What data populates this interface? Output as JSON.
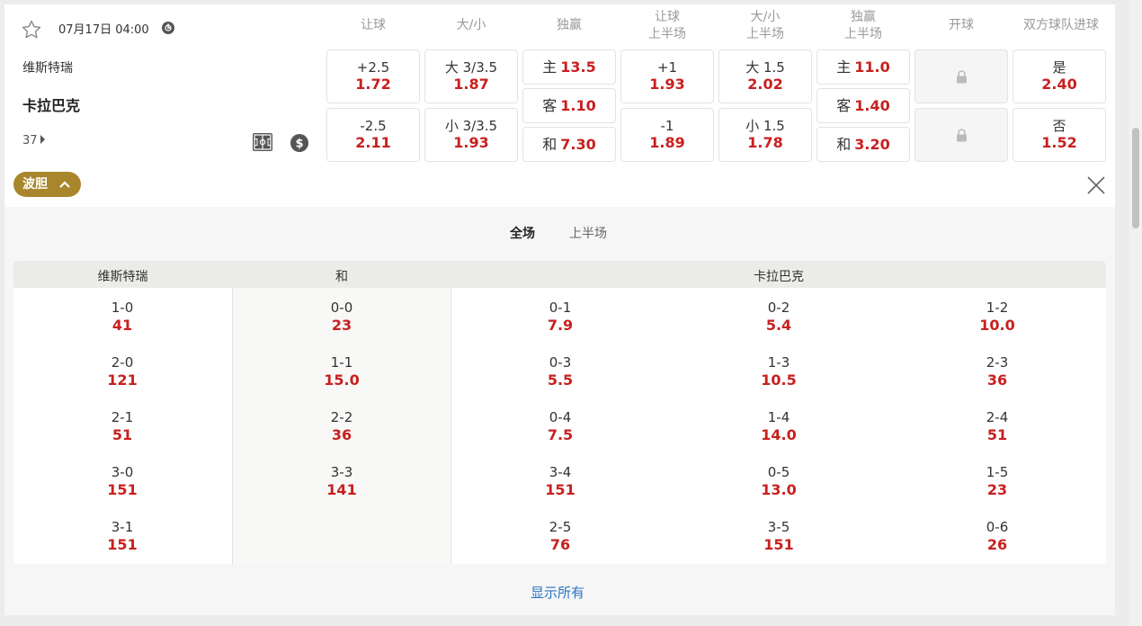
{
  "match": {
    "datetime": "07月17日 04:00",
    "home_team": "维斯特瑞",
    "away_team": "卡拉巴克",
    "more_markets_count": "37"
  },
  "headers": {
    "handicap": "让球",
    "over_under": "大/小",
    "moneyline": "独赢",
    "handicap_1h": [
      "让球",
      "上半场"
    ],
    "over_under_1h": [
      "大/小",
      "上半场"
    ],
    "moneyline_1h": [
      "独赢",
      "上半场"
    ],
    "kickoff": "开球",
    "btts": "双方球队进球"
  },
  "odds": {
    "handicap": [
      {
        "label": "+2.5",
        "odd": "1.72"
      },
      {
        "label": "-2.5",
        "odd": "2.11"
      }
    ],
    "over_under": [
      {
        "label": "大 3/3.5",
        "odd": "1.87"
      },
      {
        "label": "小 3/3.5",
        "odd": "1.93"
      }
    ],
    "moneyline": [
      {
        "label": "主",
        "odd": "13.5"
      },
      {
        "label": "客",
        "odd": "1.10"
      },
      {
        "label": "和",
        "odd": "7.30"
      }
    ],
    "handicap_1h": [
      {
        "label": "+1",
        "odd": "1.93"
      },
      {
        "label": "-1",
        "odd": "1.89"
      }
    ],
    "over_under_1h": [
      {
        "label": "大 1.5",
        "odd": "2.02"
      },
      {
        "label": "小 1.5",
        "odd": "1.78"
      }
    ],
    "moneyline_1h": [
      {
        "label": "主",
        "odd": "11.0"
      },
      {
        "label": "客",
        "odd": "1.40"
      },
      {
        "label": "和",
        "odd": "3.20"
      }
    ],
    "btts": [
      {
        "label": "是",
        "odd": "2.40"
      },
      {
        "label": "否",
        "odd": "1.52"
      }
    ]
  },
  "correct_score": {
    "toggle_label": "波胆",
    "tabs": [
      "全场",
      "上半场"
    ],
    "active_tab": "全场",
    "columns": {
      "home": "维斯特瑞",
      "draw": "和",
      "away": "卡拉巴克"
    },
    "home": [
      {
        "score": "1-0",
        "odd": "41"
      },
      {
        "score": "2-0",
        "odd": "121"
      },
      {
        "score": "2-1",
        "odd": "51"
      },
      {
        "score": "3-0",
        "odd": "151"
      },
      {
        "score": "3-1",
        "odd": "151"
      }
    ],
    "draw": [
      {
        "score": "0-0",
        "odd": "23"
      },
      {
        "score": "1-1",
        "odd": "15.0"
      },
      {
        "score": "2-2",
        "odd": "36"
      },
      {
        "score": "3-3",
        "odd": "141"
      }
    ],
    "away_col1": [
      {
        "score": "0-1",
        "odd": "7.9"
      },
      {
        "score": "0-3",
        "odd": "5.5"
      },
      {
        "score": "0-4",
        "odd": "7.5"
      },
      {
        "score": "3-4",
        "odd": "151"
      },
      {
        "score": "2-5",
        "odd": "76"
      }
    ],
    "away_col2": [
      {
        "score": "0-2",
        "odd": "5.4"
      },
      {
        "score": "1-3",
        "odd": "10.5"
      },
      {
        "score": "1-4",
        "odd": "14.0"
      },
      {
        "score": "0-5",
        "odd": "13.0"
      },
      {
        "score": "3-5",
        "odd": "151"
      }
    ],
    "away_col3": [
      {
        "score": "1-2",
        "odd": "10.0"
      },
      {
        "score": "2-3",
        "odd": "36"
      },
      {
        "score": "2-4",
        "odd": "51"
      },
      {
        "score": "1-5",
        "odd": "23"
      },
      {
        "score": "0-6",
        "odd": "26"
      }
    ],
    "show_all": "显示所有"
  },
  "colors": {
    "odds_red": "#c8201f",
    "gold": "#a8862b",
    "link_blue": "#2b74c4"
  }
}
